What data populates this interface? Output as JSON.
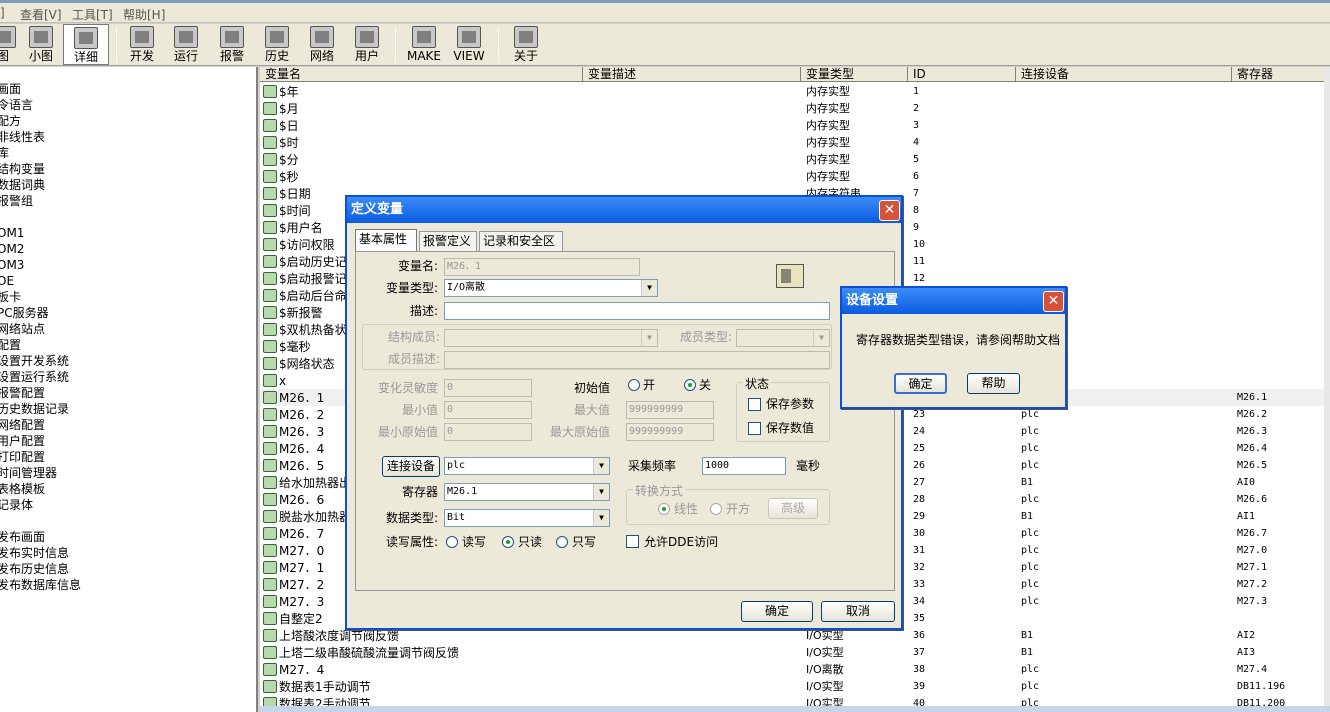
{
  "menu": [
    "]",
    "查看[V]",
    "工具[T]",
    "帮助[H]"
  ],
  "toolbar": [
    {
      "label": "图",
      "icon": "large-icons-view-icon"
    },
    {
      "label": "小图",
      "icon": "small-icons-view-icon"
    },
    {
      "label": "详细",
      "icon": "details-view-icon"
    },
    {
      "label": "开发",
      "icon": "develop-icon"
    },
    {
      "label": "运行",
      "icon": "run-icon"
    },
    {
      "label": "报警",
      "icon": "alarm-icon"
    },
    {
      "label": "历史",
      "icon": "history-icon"
    },
    {
      "label": "网络",
      "icon": "network-icon"
    },
    {
      "label": "用户",
      "icon": "user-icon"
    },
    {
      "label": "MAKE",
      "icon": "make-icon"
    },
    {
      "label": "VIEW",
      "icon": "view-icon"
    },
    {
      "label": "关于",
      "icon": "about-icon"
    }
  ],
  "tree": [
    "画面",
    "令语言",
    "配方",
    "非线性表",
    "库",
    "结构变量",
    "数据词典",
    "报警组",
    "",
    "OM1",
    "OM2",
    "OM3",
    "OE",
    "板卡",
    "PC服务器",
    "网络站点",
    "配置",
    "设置开发系统",
    "设置运行系统",
    "报警配置",
    "历史数据记录",
    "网络配置",
    "用户配置",
    "打印配置",
    "时间管理器",
    "表格模板",
    "记录体",
    "",
    "发布画面",
    "发布实时信息",
    "发布历史信息",
    "发布数据库信息"
  ],
  "columns": [
    "变量名",
    "变量描述",
    "变量类型",
    "ID",
    "连接设备",
    "寄存器"
  ],
  "rows": [
    {
      "name": "$年",
      "type": "内存实型",
      "id": "1",
      "dev": "",
      "reg": ""
    },
    {
      "name": "$月",
      "type": "内存实型",
      "id": "2",
      "dev": "",
      "reg": ""
    },
    {
      "name": "$日",
      "type": "内存实型",
      "id": "3",
      "dev": "",
      "reg": ""
    },
    {
      "name": "$时",
      "type": "内存实型",
      "id": "4",
      "dev": "",
      "reg": ""
    },
    {
      "name": "$分",
      "type": "内存实型",
      "id": "5",
      "dev": "",
      "reg": ""
    },
    {
      "name": "$秒",
      "type": "内存实型",
      "id": "6",
      "dev": "",
      "reg": ""
    },
    {
      "name": "$日期",
      "type": "内存字符串",
      "id": "7",
      "dev": "",
      "reg": ""
    },
    {
      "name": "$时间",
      "type": "",
      "id": "8",
      "dev": "",
      "reg": ""
    },
    {
      "name": "$用户名",
      "type": "",
      "id": "9",
      "dev": "",
      "reg": ""
    },
    {
      "name": "$访问权限",
      "type": "",
      "id": "10",
      "dev": "",
      "reg": ""
    },
    {
      "name": "$启动历史记",
      "type": "",
      "id": "11",
      "dev": "",
      "reg": ""
    },
    {
      "name": "$启动报警记",
      "type": "",
      "id": "12",
      "dev": "",
      "reg": ""
    },
    {
      "name": "$启动后台命",
      "type": "",
      "id": "",
      "dev": "",
      "reg": ""
    },
    {
      "name": "$新报警",
      "type": "",
      "id": "",
      "dev": "",
      "reg": ""
    },
    {
      "name": "$双机热备状",
      "type": "",
      "id": "",
      "dev": "",
      "reg": ""
    },
    {
      "name": "$毫秒",
      "type": "",
      "id": "",
      "dev": "",
      "reg": ""
    },
    {
      "name": "$网络状态",
      "type": "",
      "id": "",
      "dev": "",
      "reg": ""
    },
    {
      "name": "x",
      "type": "",
      "id": "",
      "dev": "",
      "reg": ""
    },
    {
      "name": "M26．1",
      "type": "",
      "id": "",
      "dev": "",
      "reg": "M26.1"
    },
    {
      "name": "M26．2",
      "type": "",
      "id": "23",
      "dev": "plc",
      "reg": "M26.2"
    },
    {
      "name": "M26．3",
      "type": "",
      "id": "24",
      "dev": "plc",
      "reg": "M26.3"
    },
    {
      "name": "M26．4",
      "type": "",
      "id": "25",
      "dev": "plc",
      "reg": "M26.4"
    },
    {
      "name": "M26．5",
      "type": "",
      "id": "26",
      "dev": "plc",
      "reg": "M26.5"
    },
    {
      "name": "给水加热器出",
      "type": "",
      "id": "27",
      "dev": "B1",
      "reg": "AI0"
    },
    {
      "name": "M26．6",
      "type": "",
      "id": "28",
      "dev": "plc",
      "reg": "M26.6"
    },
    {
      "name": "脱盐水加热器",
      "type": "",
      "id": "29",
      "dev": "B1",
      "reg": "AI1"
    },
    {
      "name": "M26．7",
      "type": "",
      "id": "30",
      "dev": "plc",
      "reg": "M26.7"
    },
    {
      "name": "M27．0",
      "type": "",
      "id": "31",
      "dev": "plc",
      "reg": "M27.0"
    },
    {
      "name": "M27．1",
      "type": "",
      "id": "32",
      "dev": "plc",
      "reg": "M27.1"
    },
    {
      "name": "M27．2",
      "type": "",
      "id": "33",
      "dev": "plc",
      "reg": "M27.2"
    },
    {
      "name": "M27．3",
      "type": "",
      "id": "34",
      "dev": "plc",
      "reg": "M27.3"
    },
    {
      "name": "自整定2",
      "type": "",
      "id": "35",
      "dev": "",
      "reg": ""
    },
    {
      "name": "上塔酸浓度调节阀反馈",
      "type": "I/O实型",
      "id": "36",
      "dev": "B1",
      "reg": "AI2"
    },
    {
      "name": "上塔二级串酸硫酸流量调节阀反馈",
      "type": "I/O实型",
      "id": "37",
      "dev": "B1",
      "reg": "AI3"
    },
    {
      "name": "M27．4",
      "type": "I/O离散",
      "id": "38",
      "dev": "plc",
      "reg": "M27.4"
    },
    {
      "name": "数据表1手动调节",
      "type": "I/O实型",
      "id": "39",
      "dev": "plc",
      "reg": "DB11.196"
    },
    {
      "name": "数据表2手动调节",
      "type": "I/O实型",
      "id": "40",
      "dev": "plc",
      "reg": "DB11.200"
    }
  ],
  "define": {
    "title": "定义变量",
    "tabs": [
      "基本属性",
      "报警定义",
      "记录和安全区"
    ],
    "var_name_label": "变量名:",
    "var_name": "M26．1",
    "var_type_label": "变量类型:",
    "var_type": "I/O离散",
    "desc_label": "描述:",
    "struct_member_label": "结构成员:",
    "member_type_label": "成员类型:",
    "member_desc_label": "成员描述:",
    "sensitivity_label": "变化灵敏度",
    "sensitivity": "0",
    "min_label": "最小值",
    "min": "0",
    "raw_min_label": "最小原始值",
    "raw_min": "0",
    "init_label": "初始值",
    "on_label": "开",
    "off_label": "关",
    "max_label": "最大值",
    "max": "999999999",
    "raw_max_label": "最大原始值",
    "raw_max": "999999999",
    "state_label": "状态",
    "save_param_label": "保存参数",
    "save_value_label": "保存数值",
    "connect_device_btn": "连接设备",
    "device": "plc",
    "freq_label": "采集频率",
    "freq": "1000",
    "ms_label": "毫秒",
    "register_label": "寄存器",
    "register": "M26.1",
    "convert_label": "转换方式",
    "linear_label": "线性",
    "sqrt_label": "开方",
    "advanced_label": "高级",
    "data_type_label": "数据类型:",
    "data_type": "Bit",
    "rw_label": "读写属性:",
    "rw_label_rw": "读写",
    "rw_label_r": "只读",
    "rw_label_w": "只写",
    "dde_label": "允许DDE访问",
    "ok": "确定",
    "cancel": "取消"
  },
  "msg": {
    "title": "设备设置",
    "text": "寄存器数据类型错误，请参阅帮助文档",
    "ok": "确定",
    "help": "帮助"
  }
}
